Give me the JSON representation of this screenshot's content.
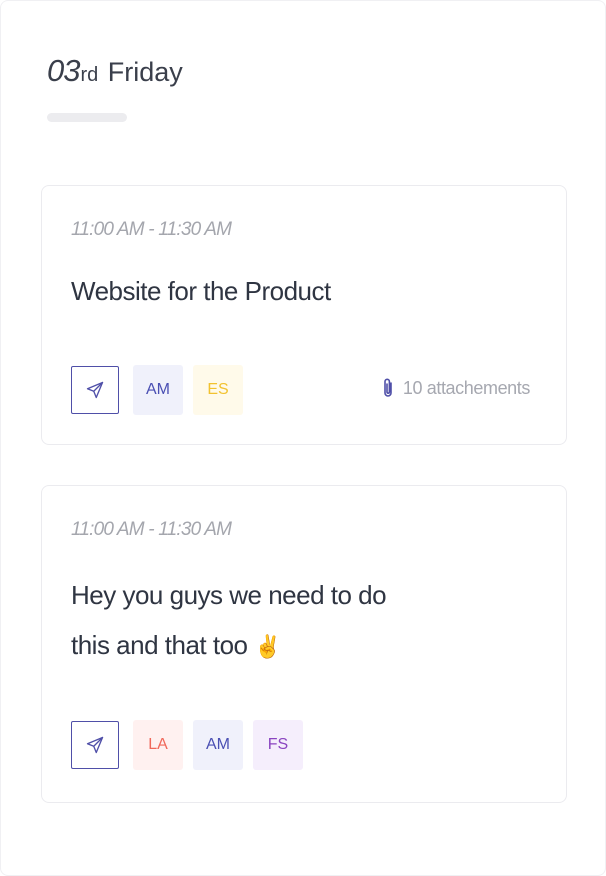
{
  "day": {
    "number": "03",
    "suffix": "rd",
    "name": "Friday"
  },
  "cards": [
    {
      "time": "11:00 AM - 11:30 AM",
      "title": "Website for the Product",
      "send_icon": "send-icon",
      "avatars": [
        {
          "initials": "AM",
          "color": "#4a4fb3",
          "bg": "#f0f1fb"
        },
        {
          "initials": "ES",
          "color": "#f2c230",
          "bg": "#fffaea"
        }
      ],
      "attachments": {
        "icon": "paperclip-icon",
        "label": "10 attachements"
      }
    },
    {
      "time": "11:00 AM - 11:30 AM",
      "title_lines": [
        "Hey you guys we need to do",
        "this and that too"
      ],
      "emoji": "✌",
      "send_icon": "send-icon",
      "avatars": [
        {
          "initials": "LA",
          "color": "#f0685a",
          "bg": "#fff1f0"
        },
        {
          "initials": "AM",
          "color": "#4a4fb3",
          "bg": "#f0f1fb"
        },
        {
          "initials": "FS",
          "color": "#8a44c0",
          "bg": "#f5eefc"
        }
      ]
    }
  ]
}
